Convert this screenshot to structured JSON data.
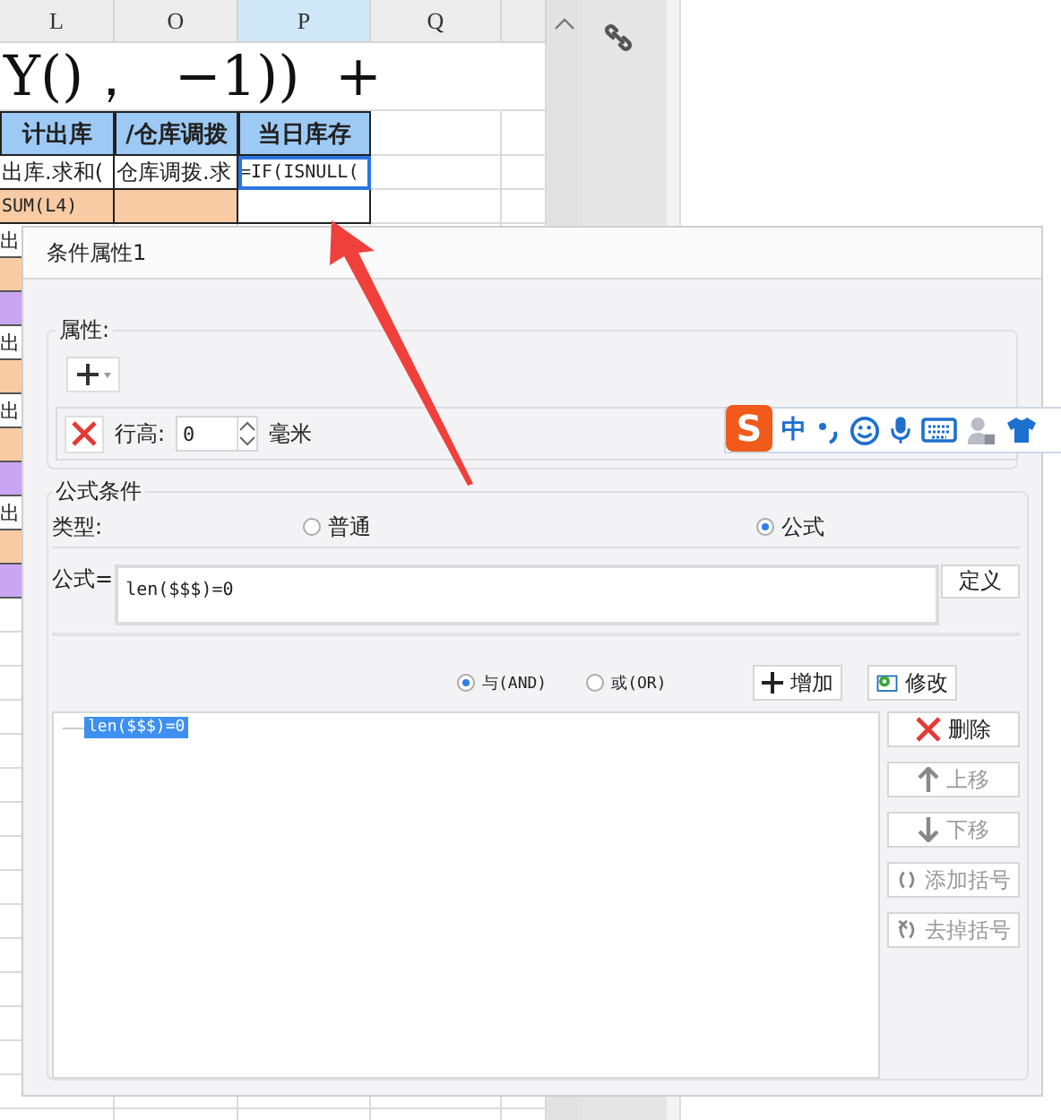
{
  "sheet": {
    "columns": [
      {
        "label": "L",
        "selected": false
      },
      {
        "label": "O",
        "selected": false
      },
      {
        "label": "P",
        "selected": true
      },
      {
        "label": "Q",
        "selected": false
      }
    ],
    "banner": "Y()，  −1))  +",
    "rows": [
      [
        {
          "text": "计出库",
          "kind": "header",
          "selected": false
        },
        {
          "text": "/仓库调拨",
          "kind": "header",
          "selected": false
        },
        {
          "text": "当日库存",
          "kind": "header",
          "selected": false
        }
      ],
      [
        {
          "text": "出库.求和(",
          "kind": "plain",
          "selected": false
        },
        {
          "text": "仓库调拨.求",
          "kind": "plain",
          "selected": false
        },
        {
          "text": "=IF(ISNULL(",
          "kind": "plain",
          "selected": true
        }
      ],
      [
        {
          "text": "SUM(L4)",
          "kind": "fill",
          "color": "#f8cba4",
          "selected": false
        },
        {
          "text": "",
          "kind": "fill",
          "color": "#f8cba4",
          "selected": false
        },
        {
          "text": "",
          "kind": "plain",
          "selected": false
        }
      ]
    ],
    "left_cells": [
      {
        "text": "出",
        "color": "#ffffff"
      },
      {
        "color": "#f8cba4"
      },
      {
        "color": "#c9a6f2"
      },
      {
        "text": "出",
        "color": "#ffffff"
      },
      {
        "color": "#f8cba4"
      },
      {
        "text": "出",
        "color": "#ffffff"
      },
      {
        "color": "#f8cba4"
      },
      {
        "color": "#c9a6f2"
      },
      {
        "text": "出",
        "color": "#ffffff"
      },
      {
        "color": "#f8cba4"
      },
      {
        "color": "#c9a6f2"
      }
    ]
  },
  "dialog": {
    "title": "条件属性1",
    "attributes": {
      "legend": "属性:",
      "row_height_label": "行高:",
      "row_height_value": "0",
      "unit": "毫米"
    },
    "formula_condition": {
      "legend": "公式条件",
      "type_label": "类型:",
      "types": [
        {
          "label": "普通",
          "selected": false
        },
        {
          "label": "公式",
          "selected": true
        }
      ],
      "formula_label": "公式=",
      "formula_value": "len($$$)=0",
      "define_button": "定义",
      "logic": [
        {
          "label": "与(AND)",
          "selected": true
        },
        {
          "label": "或(OR)",
          "selected": false
        }
      ],
      "add_button": "增加",
      "edit_button": "修改",
      "conditions": [
        {
          "text": "len($$$)=0",
          "selected": true
        }
      ],
      "side_buttons": [
        {
          "label": "删除",
          "kind": "delete",
          "disabled": false
        },
        {
          "label": "上移",
          "kind": "up",
          "disabled": true
        },
        {
          "label": "下移",
          "kind": "down",
          "disabled": true
        },
        {
          "label": "添加括号",
          "kind": "add-paren",
          "disabled": true
        },
        {
          "label": "去掉括号",
          "kind": "remove-paren",
          "disabled": true
        }
      ]
    }
  },
  "ime_toolbar": {
    "logo": "S",
    "mode": "中"
  }
}
